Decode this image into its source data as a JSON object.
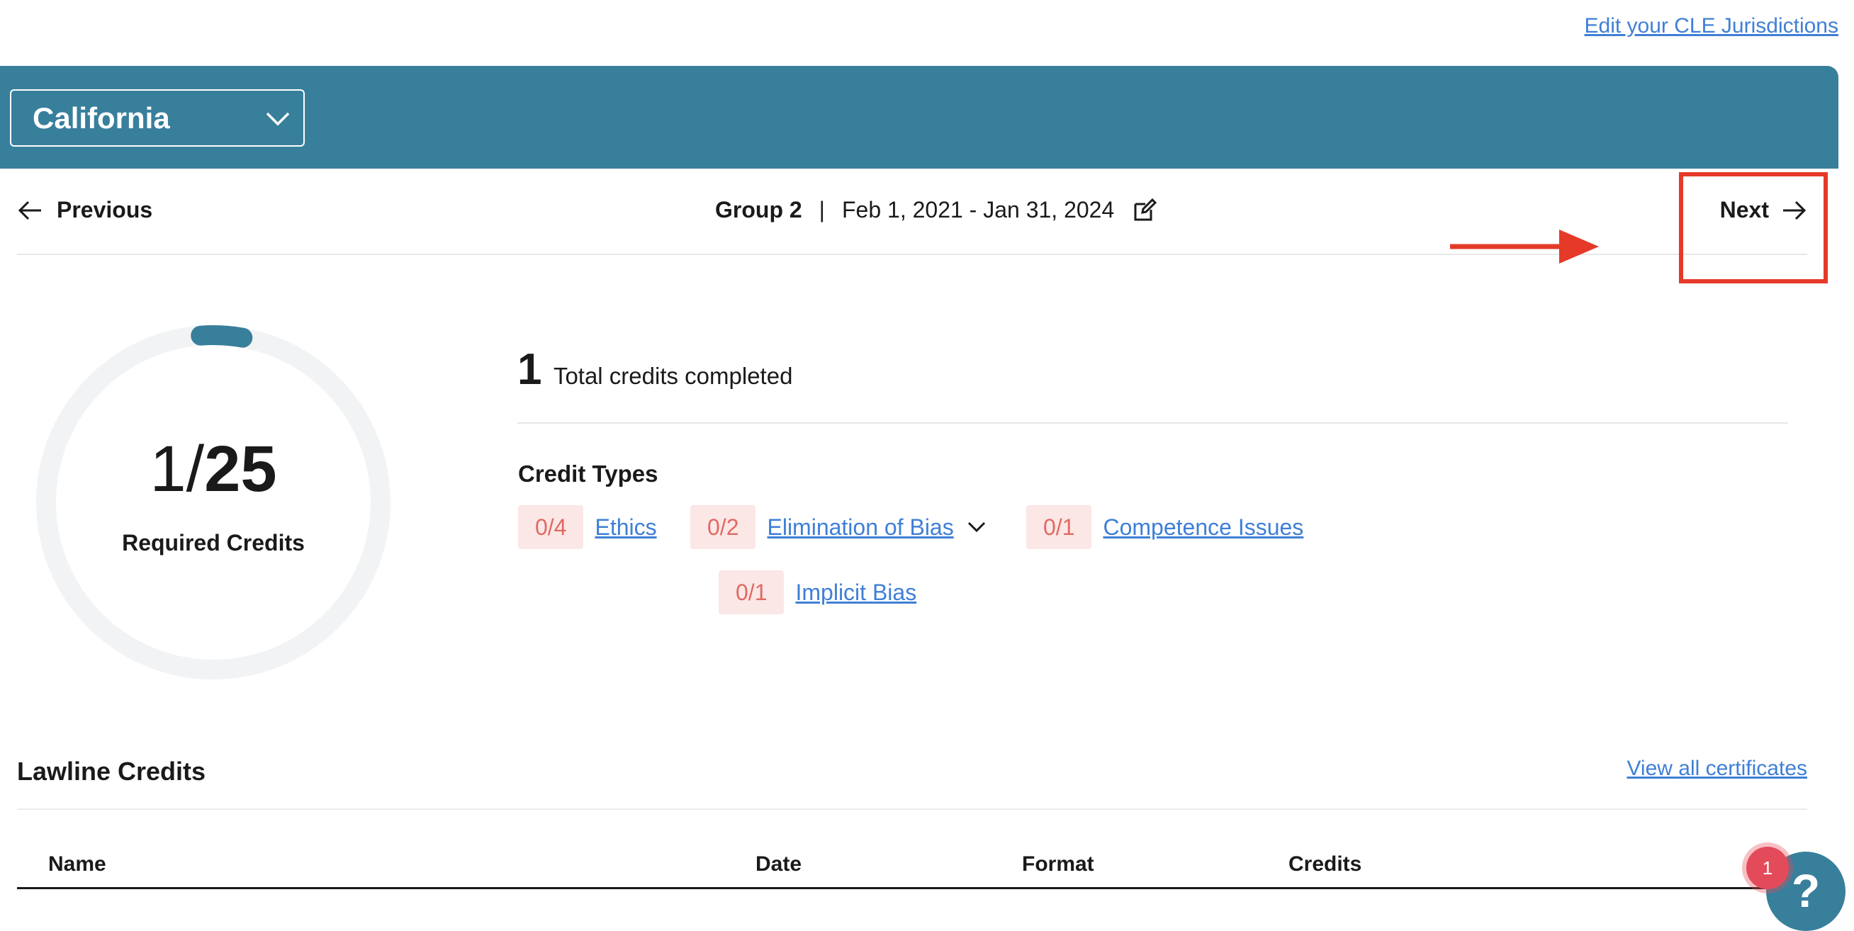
{
  "header": {
    "edit_link": "Edit your CLE Jurisdictions"
  },
  "jurisdiction": {
    "selected": "California",
    "icon": "chevron-down-icon"
  },
  "period_nav": {
    "previous_label": "Previous",
    "group": "Group 2",
    "separator": "|",
    "dates": "Feb 1, 2021 - Jan 31, 2024",
    "next_label": "Next"
  },
  "annotation": {
    "color": "#e53a28"
  },
  "progress": {
    "completed": "1",
    "slash": "/",
    "required": "25",
    "label": "Required Credits",
    "fraction": 0.04,
    "accent": "#387f9c",
    "track": "#f1f3f5"
  },
  "summary": {
    "total": "1",
    "label": "Total credits completed"
  },
  "credit_types": {
    "heading": "Credit Types",
    "items": [
      {
        "count": "0/4",
        "name": "Ethics"
      },
      {
        "count": "0/2",
        "name": "Elimination of Bias"
      },
      {
        "count": "0/1",
        "name": "Competence Issues"
      },
      {
        "count": "0/1",
        "name": "Implicit Bias"
      }
    ]
  },
  "lawline": {
    "title": "Lawline Credits",
    "view_all": "View all certificates",
    "columns": [
      "Name",
      "Date",
      "Format",
      "Credits"
    ]
  },
  "help": {
    "label": "?",
    "badge": "1"
  },
  "colors": {
    "banner": "#387f9c",
    "link": "#3f7fd6",
    "badge_bg": "#fbe7e6",
    "badge_text": "#e06a63"
  }
}
